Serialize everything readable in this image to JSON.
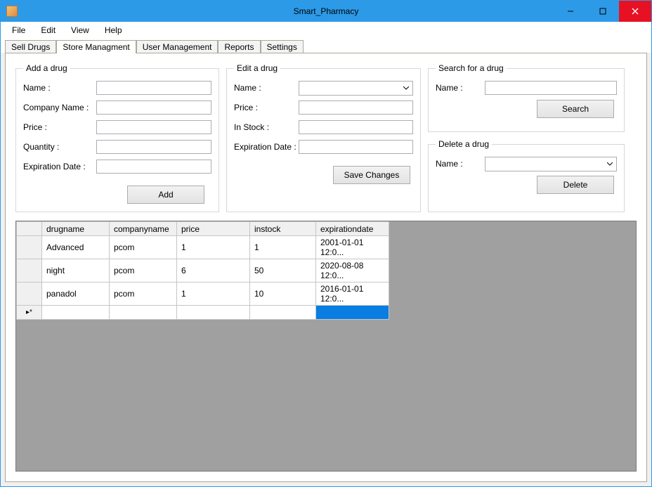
{
  "window": {
    "title": "Smart_Pharmacy"
  },
  "menubar": {
    "file": "File",
    "edit": "Edit",
    "view": "View",
    "help": "Help"
  },
  "tabs": {
    "sell_drugs": "Sell Drugs",
    "store_management": "Store Managment",
    "user_management": "User Management",
    "reports": "Reports",
    "settings": "Settings"
  },
  "groups": {
    "add": {
      "legend": "Add a drug",
      "name": "Name :",
      "company": "Company Name :",
      "price": "Price :",
      "quantity": "Quantity :",
      "expdate": "Expiration Date :",
      "button": "Add"
    },
    "edit": {
      "legend": "Edit a drug",
      "name": "Name :",
      "price": "Price :",
      "instock": "In Stock :",
      "expdate": "Expiration Date :",
      "button": "Save Changes"
    },
    "search": {
      "legend": "Search for a drug",
      "name": "Name :",
      "button": "Search"
    },
    "delete": {
      "legend": "Delete a drug",
      "name": "Name :",
      "button": "Delete"
    }
  },
  "grid": {
    "headers": {
      "drugname": "drugname",
      "companyname": "companyname",
      "price": "price",
      "instock": "instock",
      "expirationdate": "expirationdate"
    },
    "rows": [
      {
        "drugname": "Advanced",
        "companyname": "pcom",
        "price": "1",
        "instock": "1",
        "expirationdate": "2001-01-01 12:0..."
      },
      {
        "drugname": "night",
        "companyname": "pcom",
        "price": "6",
        "instock": "50",
        "expirationdate": "2020-08-08 12:0..."
      },
      {
        "drugname": "panadol",
        "companyname": "pcom",
        "price": "1",
        "instock": "10",
        "expirationdate": "2016-01-01 12:0..."
      }
    ],
    "new_row_marker": "▸*"
  }
}
